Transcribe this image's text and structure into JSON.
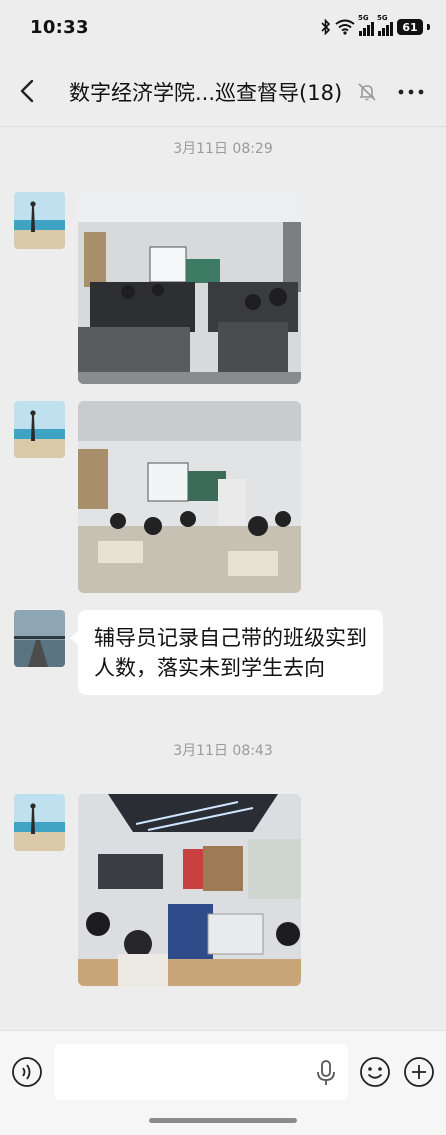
{
  "status_bar": {
    "time": "10:33",
    "network_1": "5G",
    "network_2": "5G",
    "battery": "61"
  },
  "header": {
    "title": "数字经济学院...巡查督导(18)"
  },
  "messages": [
    {
      "type": "timestamp",
      "text": "3月11日 08:29"
    },
    {
      "type": "image",
      "description_icon": "classroom-photo"
    },
    {
      "type": "image",
      "description_icon": "classroom-photo"
    },
    {
      "type": "text",
      "text_line1": "辅导员记录自己带的班级实到",
      "text_line2": "人数，落实未到学生去向"
    },
    {
      "type": "timestamp",
      "text": "3月11日 08:43"
    },
    {
      "type": "image",
      "description_icon": "computer-lab-photo"
    }
  ],
  "input_bar": {
    "placeholder": ""
  },
  "colors": {
    "background": "#ededed",
    "bubble": "#ffffff",
    "timestamp": "#9a9a9a"
  }
}
